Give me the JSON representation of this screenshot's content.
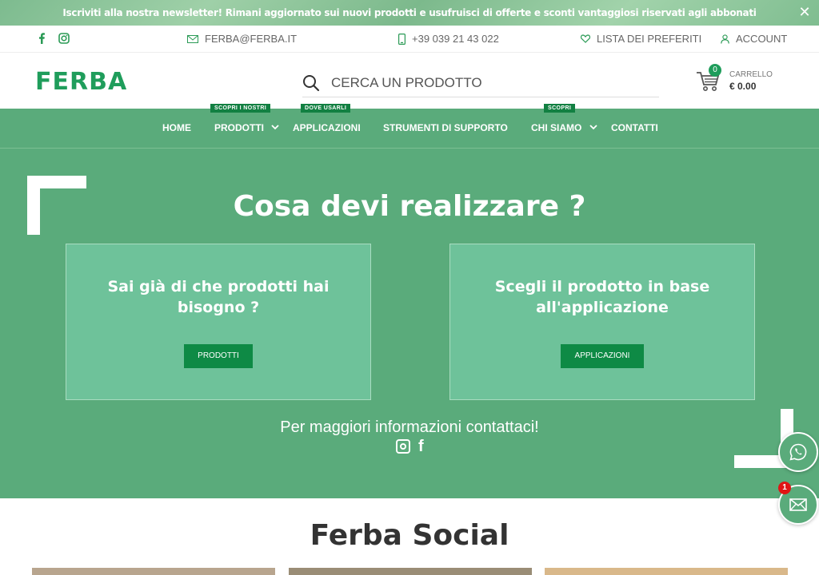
{
  "topbar": {
    "message": "Iscriviti alla nostra newsletter! Rimani aggiornato sui nuovi prodotti e usufruisci di offerte e sconti vantaggiosi riservati agli abbonati",
    "close_icon": "close-icon"
  },
  "contact": {
    "email": "FERBA@FERBA.IT",
    "phone": "+39 039 21 43 022",
    "wishlist": "LISTA DEI PREFERITI",
    "account": "ACCOUNT"
  },
  "header": {
    "logo": "FERBA",
    "search_placeholder": "CERCA UN PRODOTTO",
    "cart_label": "CARRELLO",
    "cart_total": "€ 0.00",
    "cart_count": "0"
  },
  "nav": {
    "home": "HOME",
    "products": "PRODOTTI",
    "products_tag": "SCOPRI I NOSTRI",
    "applications": "APPLICAZIONI",
    "applications_tag": "DOVE USARLI",
    "tools": "STRUMENTI DI SUPPORTO",
    "about": "CHI SIAMO",
    "about_tag": "SCOPRI",
    "contacts": "CONTATTI"
  },
  "hero": {
    "title": "Cosa devi realizzare ?",
    "box1_title": "Sai già di che prodotti hai bisogno ?",
    "box1_button": "PRODOTTI",
    "box2_title": "Scegli il prodotto in base all'applicazione",
    "box2_button": "APPLICAZIONI",
    "info": "Per maggiori informazioni contattaci!"
  },
  "floating": {
    "mail_badge": "1"
  },
  "social": {
    "title": "Ferba Social"
  },
  "colors": {
    "brand_green": "#1f9d5b",
    "hero_green": "#5aab7b",
    "box_green": "#6ec29a",
    "button_green": "#0e8a45"
  }
}
